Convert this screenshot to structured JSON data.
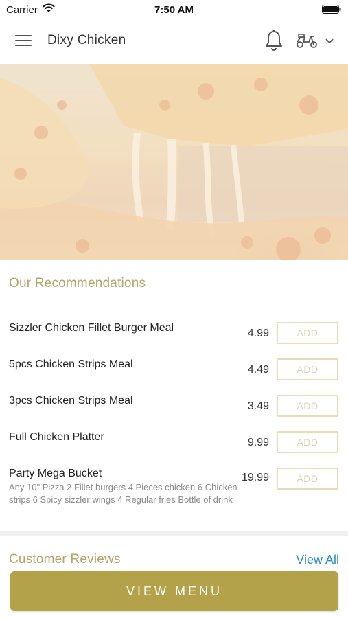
{
  "status_bar": {
    "carrier": "Carrier",
    "time": "7:50 AM",
    "icons": [
      "wifi-icon",
      "battery-icon"
    ]
  },
  "header": {
    "title": "Dixy Chicken",
    "icons": [
      "menu-icon",
      "bell-icon",
      "scooter-icon",
      "chevron-down-icon"
    ]
  },
  "hero": {
    "image": "cheese-pizza-slice-photo"
  },
  "recommendations": {
    "title": "Our Recommendations",
    "items": [
      {
        "name": "Sizzler Chicken Fillet Burger Meal",
        "price": "4.99",
        "add_label": "ADD",
        "description": ""
      },
      {
        "name": "5pcs Chicken Strips Meal",
        "price": "4.49",
        "add_label": "ADD",
        "description": ""
      },
      {
        "name": "3pcs Chicken Strips Meal",
        "price": "3.49",
        "add_label": "ADD",
        "description": ""
      },
      {
        "name": "Full Chicken Platter",
        "price": "9.99",
        "add_label": "ADD",
        "description": ""
      },
      {
        "name": "Party Mega Bucket",
        "price": "19.99",
        "add_label": "ADD",
        "description": "Any 10\" Pizza 2 Fillet burgers 4 Pieces chicken 6 Chicken strips 6 Spicy sizzler wings 4 Regular fries Bottle of drink"
      }
    ]
  },
  "reviews": {
    "title": "Customer Reviews",
    "view_all": "View All"
  },
  "footer": {
    "view_menu": "VIEW MENU"
  },
  "colors": {
    "accent": "#b3a249",
    "section_title": "#b5a36a",
    "link": "#2a8fbf",
    "add_border": "#e6ddb8"
  }
}
